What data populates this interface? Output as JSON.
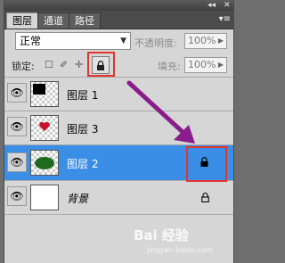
{
  "titlebar": {
    "collapse_glyph": "◂◂",
    "close_glyph": "✕"
  },
  "tabs": [
    {
      "label": "图层",
      "active": true
    },
    {
      "label": "通道",
      "active": false
    },
    {
      "label": "路径",
      "active": false
    }
  ],
  "panel_menu_glyph": "▾≡",
  "blend_mode": {
    "value": "正常"
  },
  "opacity": {
    "label": "不透明度:",
    "value": "100%"
  },
  "lock": {
    "label": "锁定:",
    "icons": [
      "transparent-pixels-lock-icon",
      "brush-lock-icon",
      "move-lock-icon",
      "lock-all-icon"
    ]
  },
  "fill": {
    "label": "填充:",
    "value": "100%"
  },
  "layers": [
    {
      "name": "图层 1",
      "selected": false,
      "thumb": "black-square",
      "locked": false
    },
    {
      "name": "图层 3",
      "selected": false,
      "thumb": "red-heart",
      "locked": false
    },
    {
      "name": "图层 2",
      "selected": true,
      "thumb": "green-circle",
      "locked": true
    },
    {
      "name": "背景",
      "selected": false,
      "thumb": "white",
      "locked": true
    }
  ],
  "colors": {
    "selection": "#3a8ee6",
    "highlight": "#e0362e",
    "arrow": "#8a1d8c",
    "layer3_heart": "#c8102e",
    "layer2_ellipse": "#1e6b1e"
  },
  "watermark": {
    "text": "Bai 经验",
    "url": "jingyan.baidu.com"
  }
}
